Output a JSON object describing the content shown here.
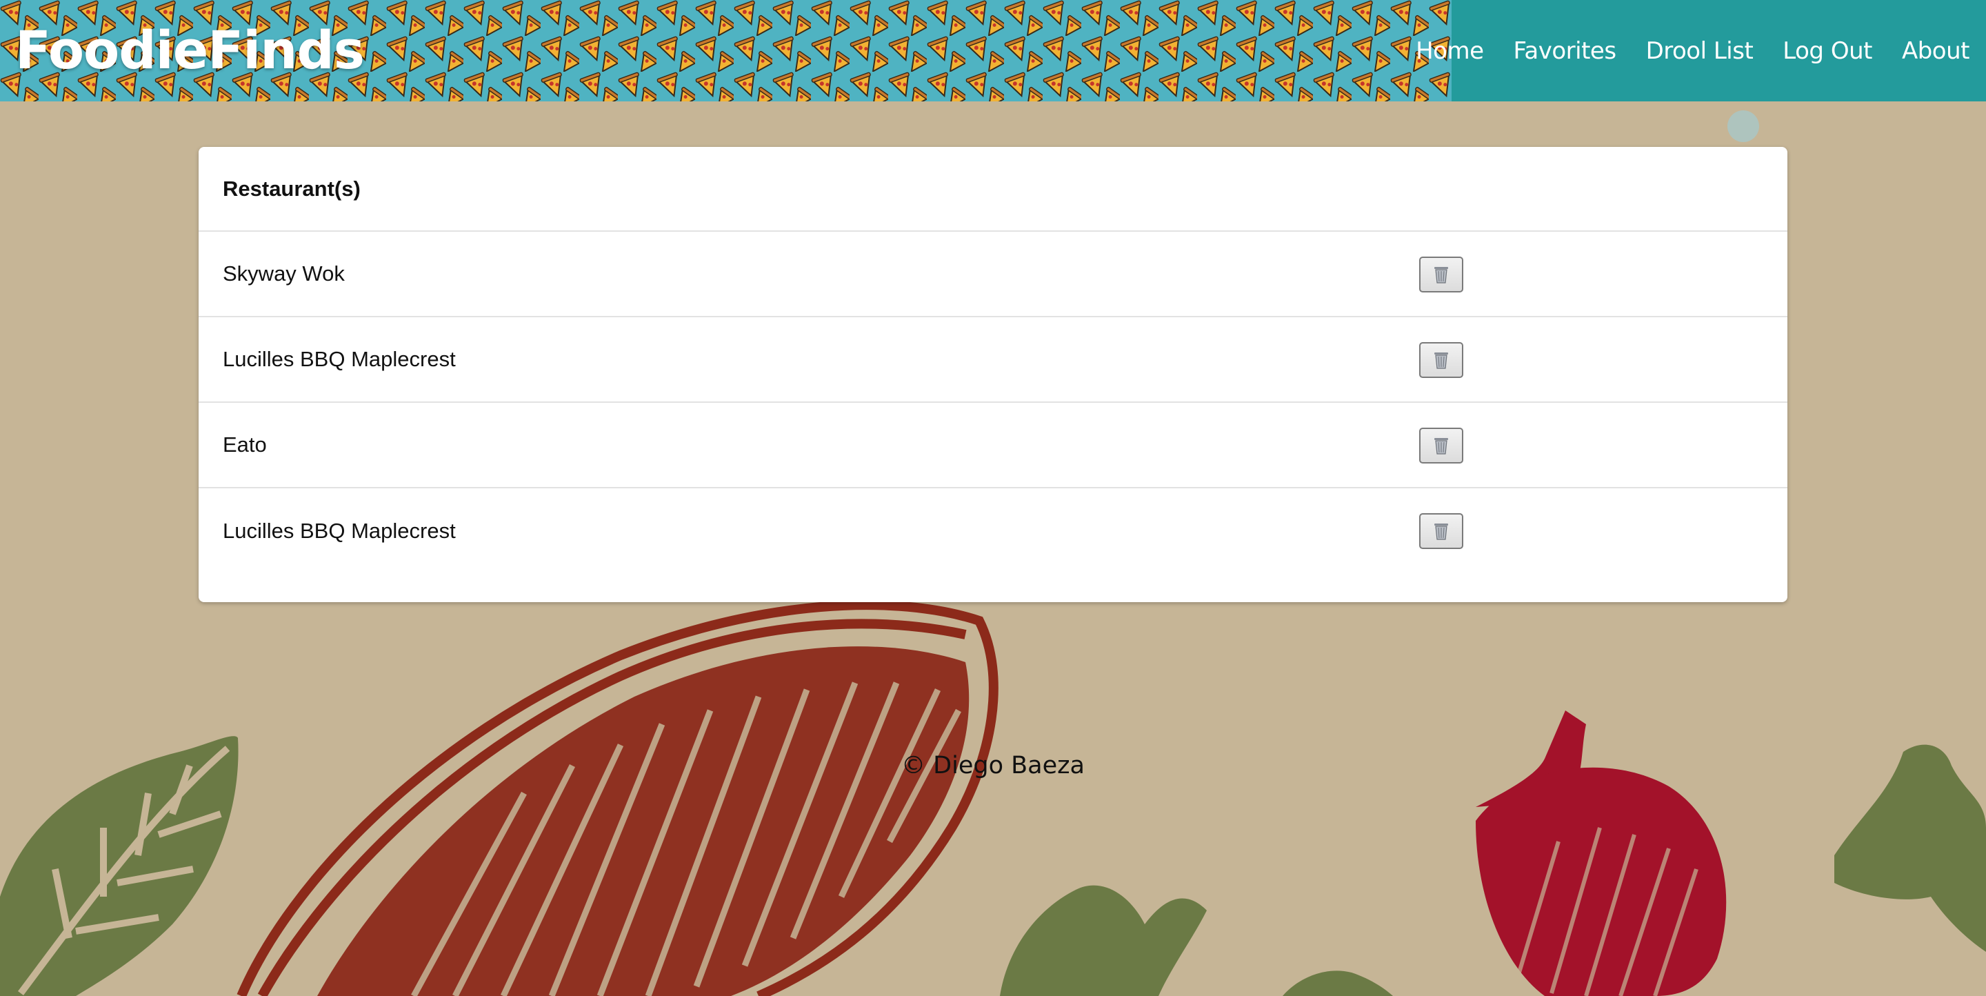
{
  "brand": {
    "title": "FoodieFinds"
  },
  "nav": {
    "items": [
      {
        "label": "Home"
      },
      {
        "label": "Favorites"
      },
      {
        "label": "Drool List"
      },
      {
        "label": "Log Out"
      },
      {
        "label": "About"
      }
    ]
  },
  "table": {
    "header": "Restaurant(s)",
    "rows": [
      {
        "name": "Skyway Wok",
        "action_icon": "trash-icon"
      },
      {
        "name": "Lucilles BBQ Maplecrest",
        "action_icon": "trash-icon"
      },
      {
        "name": "Eato",
        "action_icon": "trash-icon"
      },
      {
        "name": "Lucilles BBQ Maplecrest",
        "action_icon": "trash-icon"
      }
    ]
  },
  "footer": {
    "text": "© Diego Baeza"
  },
  "colors": {
    "page_background": "#c6b596",
    "header_pattern": "#4fb3c2",
    "navbar": "#239b9c",
    "card": "#ffffff",
    "illustration_red": "#8c2a1a",
    "illustration_green": "#6b7a45",
    "strawberry": "#a3122a"
  }
}
